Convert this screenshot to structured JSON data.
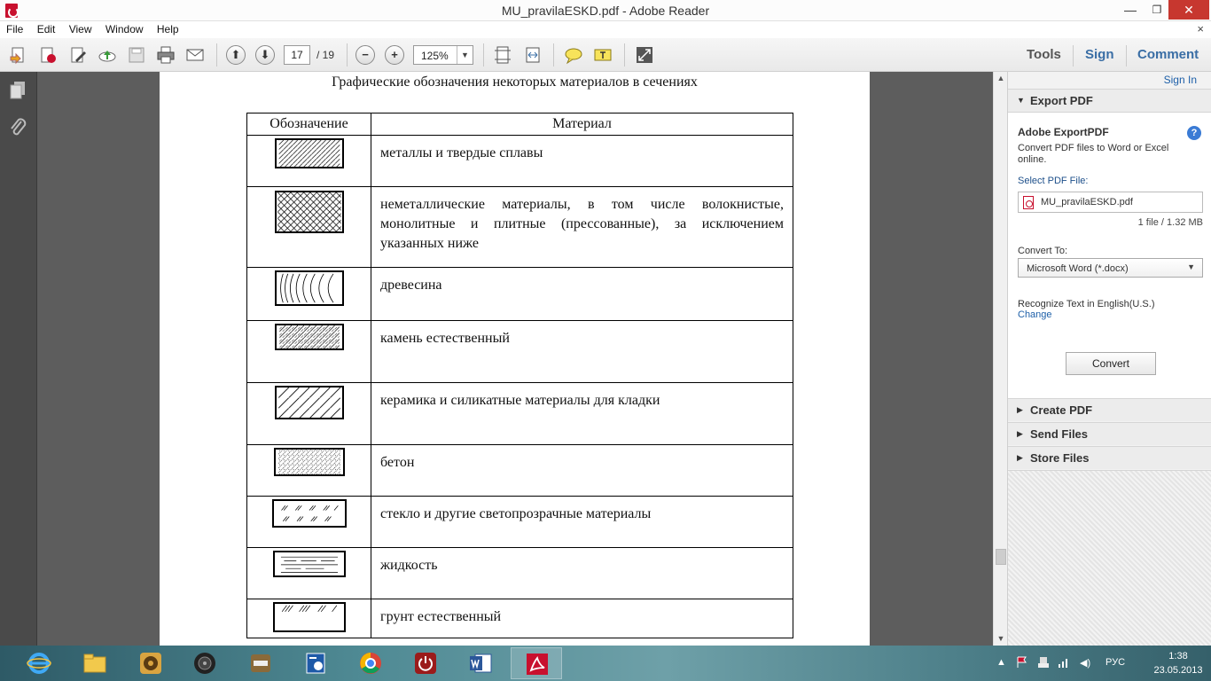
{
  "window": {
    "title": "MU_pravilaESKD.pdf - Adobe Reader",
    "minimize_glyph": "—",
    "maximize_glyph": "❐",
    "close_glyph": "✕"
  },
  "menu": {
    "items": [
      "File",
      "Edit",
      "View",
      "Window",
      "Help"
    ],
    "close_glyph": "×"
  },
  "toolbar": {
    "page_current": "17",
    "page_total": "/ 19",
    "zoom": "125%",
    "zoom_arrow": "▼",
    "prev_glyph": "⬆",
    "next_glyph": "⬇",
    "zoom_out_glyph": "−",
    "zoom_in_glyph": "+",
    "tools": "Tools",
    "sign": "Sign",
    "comment": "Comment"
  },
  "document": {
    "caption": "Графические обозначения некоторых материалов в сечениях",
    "headers": [
      "Обозначение",
      "Материал"
    ],
    "rows": [
      "металлы и твердые сплавы",
      "неметаллические материалы, в том числе волокнистые, монолитные и плитные (прессованные), за исключением указанных ниже",
      "древесина",
      "камень естественный",
      "керамика и силикатные материалы для кладки",
      "бетон",
      "стекло и другие светопрозрачные материалы",
      "жидкость",
      "грунт естественный"
    ]
  },
  "scrollbar": {
    "up_glyph": "▲",
    "down_glyph": "▼"
  },
  "right_panel": {
    "sign_in": "Sign In",
    "export_pdf": "Export PDF",
    "export_title": "Adobe ExportPDF",
    "export_desc": "Convert PDF files to Word or Excel online.",
    "select_label": "Select PDF File:",
    "file_name": "MU_pravilaESKD.pdf",
    "file_size": "1 file / 1.32 MB",
    "convert_to_label": "Convert To:",
    "convert_to_value": "Microsoft Word (*.docx)",
    "recognize": "Recognize Text in English(U.S.)",
    "change": "Change",
    "convert_button": "Convert",
    "create_pdf": "Create PDF",
    "send_files": "Send Files",
    "store_files": "Store Files",
    "help_glyph": "?",
    "expanded_glyph": "▼",
    "collapsed_glyph": "▶",
    "dropdown_glyph": "▼"
  },
  "taskbar": {
    "language": "РУС",
    "time": "1:38",
    "date": "23.05.2013",
    "tray_up_glyph": "▲",
    "tray_volume_glyph": "◀)"
  },
  "colors": {
    "accent_blue": "#1d5fa8",
    "adobe_red": "#c8102e",
    "dark_bg": "#5d5d5d",
    "nav_bg": "#4a4a4a"
  }
}
